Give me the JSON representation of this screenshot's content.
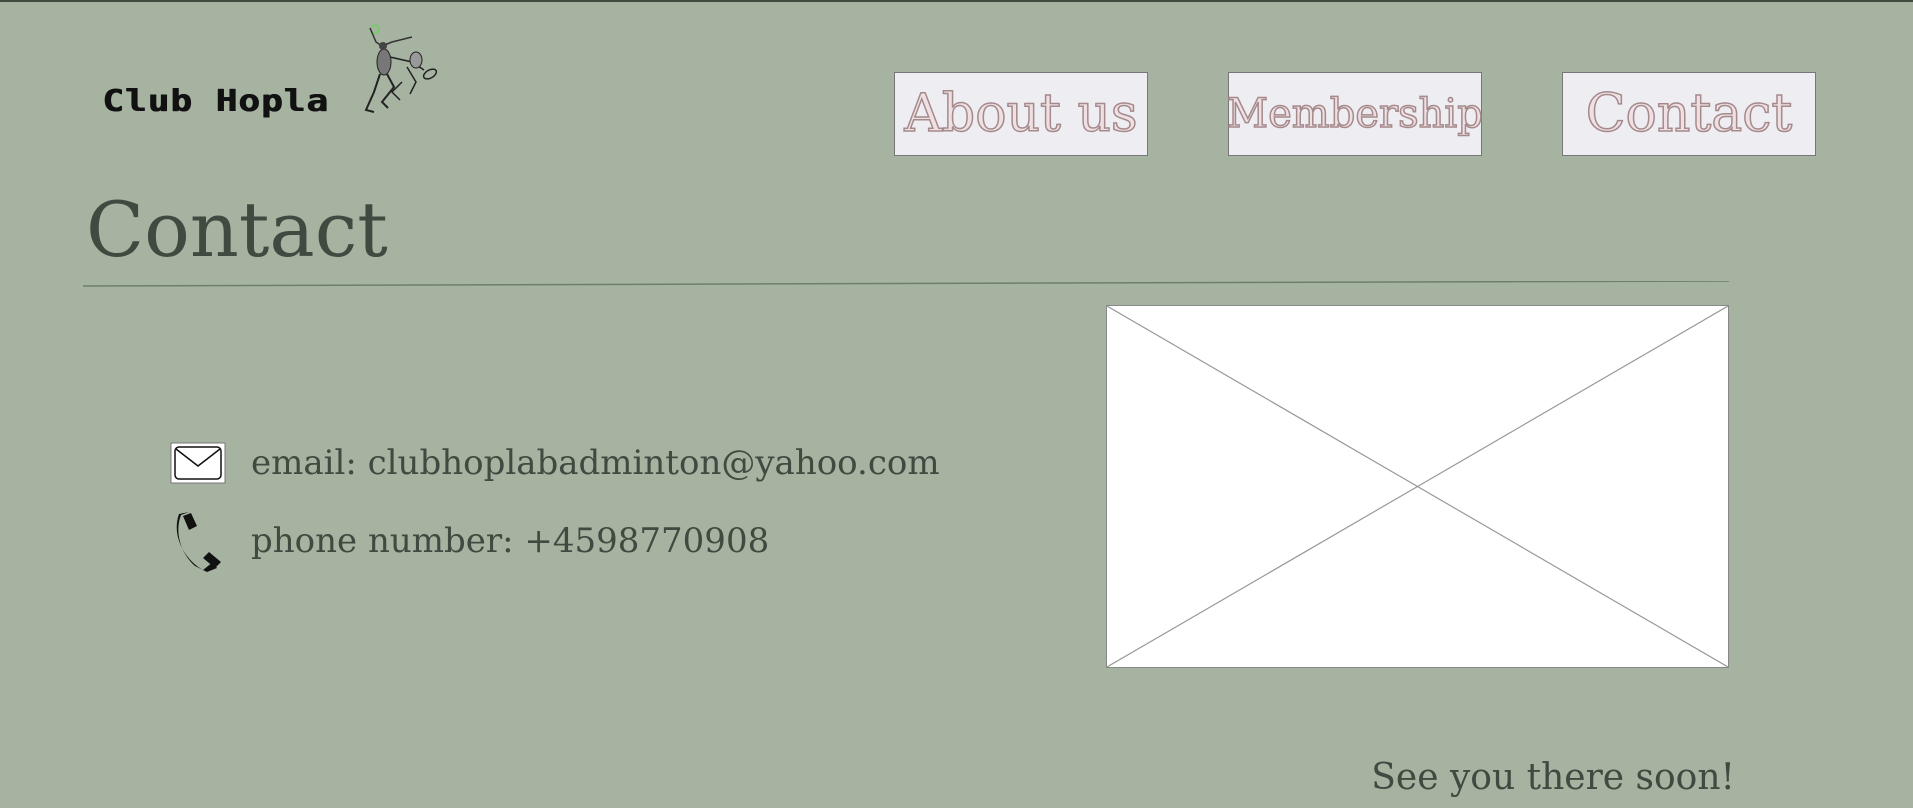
{
  "header": {
    "logo_text": "Club Hopla"
  },
  "nav": {
    "about_label": "About us",
    "membership_label": "Membership",
    "contact_label": "Contact"
  },
  "page": {
    "title": "Contact"
  },
  "contact": {
    "email_text": "email: clubhoplabadminton@yahoo.com",
    "phone_text": "phone number: +4598770908",
    "email_icon": "envelope-icon",
    "phone_icon": "phone-icon"
  },
  "footer": {
    "note": "See you there soon!"
  },
  "colors": {
    "background": "#a7b3a1",
    "button_bg": "#eeedf2",
    "button_text_outline": "#a58a8c",
    "text": "#3f4a40"
  }
}
